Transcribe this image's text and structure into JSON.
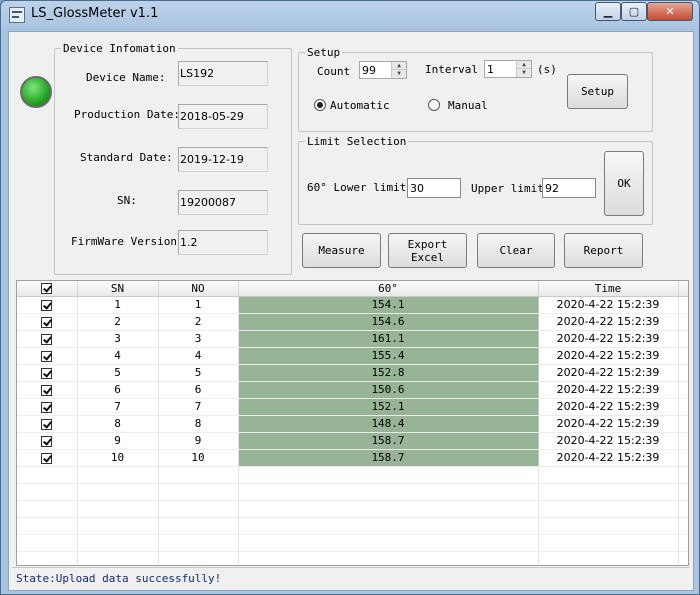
{
  "window": {
    "title": "LS_GlossMeter v1.1",
    "caption_buttons": {
      "minimize": "▁",
      "maximize": "▢",
      "close": "✕"
    }
  },
  "device_info": {
    "legend": "Device Infomation",
    "name_label": "Device Name:",
    "name_value": "LS192",
    "production_date_label": "Production Date:",
    "production_date_value": "2018-05-29",
    "standard_date_label": "Standard Date:",
    "standard_date_value": "2019-12-19",
    "sn_label": "SN:",
    "sn_value": "19200087",
    "firmware_label": "FirmWare Version:",
    "firmware_value": "1.2"
  },
  "setup": {
    "legend": "Setup",
    "count_label": "Count",
    "count_value": "99",
    "interval_label": "Interval",
    "interval_value": "1",
    "interval_unit": "(s)",
    "mode_automatic": "Automatic",
    "mode_manual": "Manual",
    "selected_mode": "automatic",
    "setup_button": "Setup"
  },
  "limit": {
    "legend": "Limit Selection",
    "lower_label": "60° Lower limit",
    "lower_value": "30",
    "upper_label": "Upper limit",
    "upper_value": "92",
    "ok_button": "OK"
  },
  "actions": {
    "measure": "Measure",
    "export_excel": "Export Excel",
    "clear": "Clear",
    "report": "Report"
  },
  "table": {
    "columns": [
      "",
      "SN",
      "NO",
      "60°",
      "Time"
    ],
    "rows": [
      {
        "checked": true,
        "sn": "1",
        "no": "1",
        "gloss": "154.1",
        "time": "2020-4-22 15:2:39"
      },
      {
        "checked": true,
        "sn": "2",
        "no": "2",
        "gloss": "154.6",
        "time": "2020-4-22 15:2:39"
      },
      {
        "checked": true,
        "sn": "3",
        "no": "3",
        "gloss": "161.1",
        "time": "2020-4-22 15:2:39"
      },
      {
        "checked": true,
        "sn": "4",
        "no": "4",
        "gloss": "155.4",
        "time": "2020-4-22 15:2:39"
      },
      {
        "checked": true,
        "sn": "5",
        "no": "5",
        "gloss": "152.8",
        "time": "2020-4-22 15:2:39"
      },
      {
        "checked": true,
        "sn": "6",
        "no": "6",
        "gloss": "150.6",
        "time": "2020-4-22 15:2:39"
      },
      {
        "checked": true,
        "sn": "7",
        "no": "7",
        "gloss": "152.1",
        "time": "2020-4-22 15:2:39"
      },
      {
        "checked": true,
        "sn": "8",
        "no": "8",
        "gloss": "148.4",
        "time": "2020-4-22 15:2:39"
      },
      {
        "checked": true,
        "sn": "9",
        "no": "9",
        "gloss": "158.7",
        "time": "2020-4-22 15:2:39"
      },
      {
        "checked": true,
        "sn": "10",
        "no": "10",
        "gloss": "158.7",
        "time": "2020-4-22 15:2:39"
      }
    ],
    "empty_rows": 6
  },
  "status": {
    "text": "State:Upload data successfully!"
  },
  "colors": {
    "led": "#22a522",
    "gloss_cell": "#98b497",
    "status_text": "#102a86"
  }
}
